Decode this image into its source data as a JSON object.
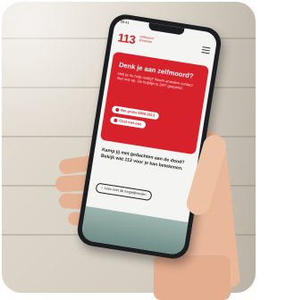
{
  "phone": {
    "status_time": "09:41",
    "logo_number": "113",
    "logo_subtitle": "zelfmoord preventie",
    "help_card": {
      "title": "Denk je aan zelfmoord?",
      "body": "Heb je nu hulp nodig? Neem anoniem contact met ons op. De hulplijn is 24/7 geopend.",
      "call_button": "Bel gratis 0800-0113",
      "chat_button": "Chat met ons"
    },
    "secondary_text": "Kamp jij met gedachten aan de dood? Bekijk wat 113 voor je kan betekenen.",
    "link_pill": "Lees over de mogelijkheden"
  },
  "colors": {
    "brand_red": "#d8222b",
    "phone_body": "#1c1d20",
    "background_wood": "#ddd6cb",
    "skin": "#e9b89a"
  }
}
